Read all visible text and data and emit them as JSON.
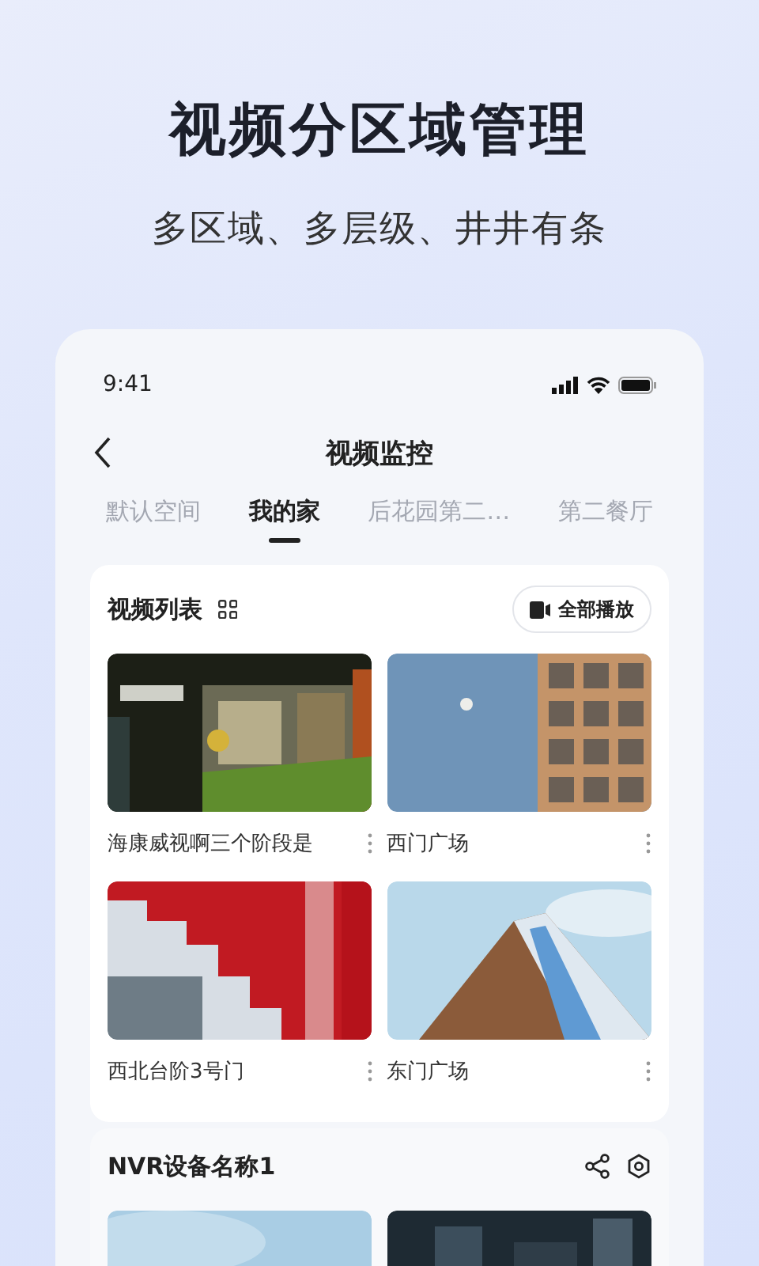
{
  "headline": "视频分区域管理",
  "subtitle": "多区域、多层级、井井有条",
  "phone": {
    "status_time": "9:41",
    "nav_title": "视频监控",
    "tabs": [
      {
        "label": "默认空间",
        "selected": false
      },
      {
        "label": "我的家",
        "selected": true
      },
      {
        "label": "后花园第二…",
        "selected": false
      },
      {
        "label": "第二餐厅",
        "selected": false
      }
    ],
    "video_list": {
      "title": "视频列表",
      "play_all": "全部播放",
      "videos": [
        {
          "name": "海康威视啊三个阶段是"
        },
        {
          "name": "西门广场"
        },
        {
          "name": "西北台阶3号门"
        },
        {
          "name": "东门广场"
        }
      ]
    },
    "nvr": {
      "title": "NVR设备名称1"
    }
  }
}
